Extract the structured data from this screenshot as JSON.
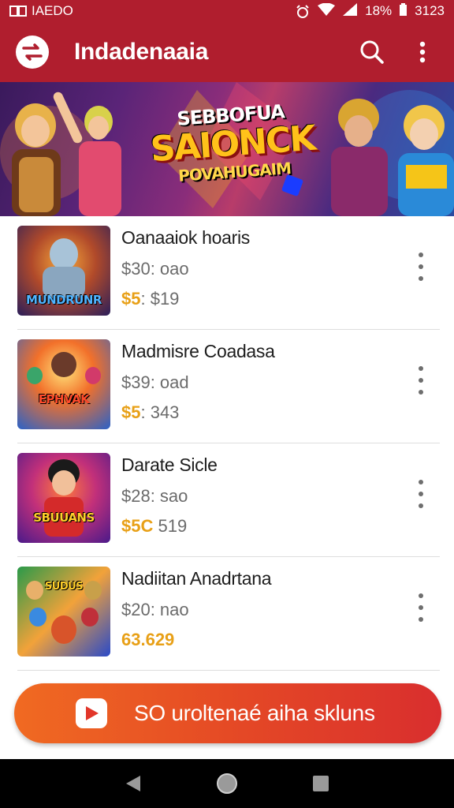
{
  "status_bar": {
    "left_text": "IAEDO",
    "battery": "18%",
    "time": "3123"
  },
  "app_bar": {
    "title": "Indadenaaia",
    "icons": [
      "app-logo-icon",
      "search-icon",
      "more-vert-icon"
    ]
  },
  "banner": {
    "kicker": "SEBBOFUA",
    "title": "SAIONCK",
    "subtitle": "POVAHUGAIM"
  },
  "items": [
    {
      "title": "Oanaaiok hoaris",
      "price": "$30: oao",
      "sale_accent": "$5",
      "sale_rest": ": $19",
      "thumb_label": "MUNDRUNR",
      "colors": [
        "#1e3a8a",
        "#f59e0b"
      ]
    },
    {
      "title": "Madmisre Coadasa",
      "price": "$39: oad",
      "sale_accent": "$5",
      "sale_rest": ": 343",
      "thumb_label": "EPHVAK",
      "colors": [
        "#dc2626",
        "#facc15"
      ]
    },
    {
      "title": "Darate Sicle",
      "price": "$28: sao",
      "sale_accent": "$5C",
      "sale_rest": " 519",
      "thumb_label": "SBUUANS",
      "colors": [
        "#7c3aed",
        "#f97316"
      ]
    },
    {
      "title": "Nadiitan Anadrtana",
      "price": "$20: nao",
      "sale_accent": "63.629",
      "sale_rest": "",
      "thumb_label": "SUDUS",
      "colors": [
        "#16a34a",
        "#2563eb"
      ]
    }
  ],
  "cta": {
    "label": "SO uroltenaé aiha skluns"
  },
  "nav": [
    "back-icon",
    "home-icon",
    "recents-icon"
  ],
  "theme": {
    "primary": "#b01e2e",
    "accent": "#e8a017",
    "cta_start": "#f06a22",
    "cta_end": "#d92e2e"
  }
}
